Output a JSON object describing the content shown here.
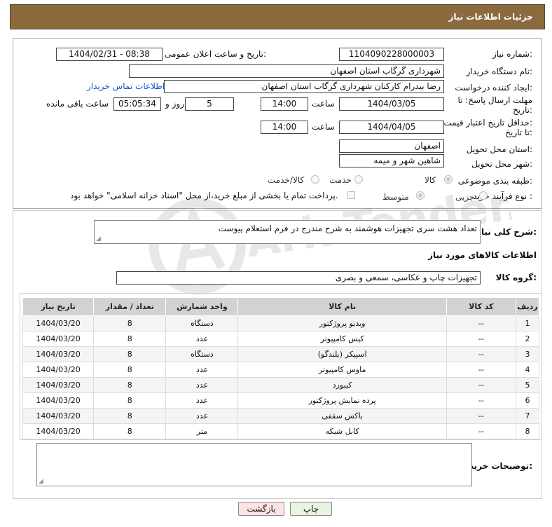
{
  "header": {
    "title": "جزئیات اطلاعات نیاز"
  },
  "form": {
    "need_number": {
      "label": "شماره نیاز:",
      "value": "1104090228000003"
    },
    "announce_datetime": {
      "label": "تاریخ و ساعت اعلان عمومی:",
      "value": "1404/02/31 - 08:38"
    },
    "buyer_org": {
      "label": "نام دستگاه خریدار:",
      "value": "شهرداری گرگاب استان اصفهان"
    },
    "requester": {
      "label": "ایجاد کننده درخواست:",
      "value": "رضا بیدرام کارکنان شهرداری گرگاب استان اصفهان",
      "contact_link": "اطلاعات تماس خریدار"
    },
    "reply_deadline": {
      "label_line1": "مهلت ارسال پاسخ: تا",
      "label_line2": "تاریخ:",
      "date": "1404/03/05",
      "time_label": "ساعت",
      "time": "14:00",
      "days": "5",
      "days_label": "روز و",
      "remaining": "05:05:34",
      "remaining_label": "ساعت باقی مانده"
    },
    "price_validity": {
      "label_line1": "حداقل تاریخ اعتبار قیمت:",
      "label_line2": "تا تاریخ:",
      "date": "1404/04/05",
      "time_label": "ساعت",
      "time": "14:00"
    },
    "delivery_province": {
      "label": "استان محل تحویل:",
      "value": "اصفهان"
    },
    "delivery_city": {
      "label": "شهر محل تحویل:",
      "value": "شاهین شهر و میمه"
    },
    "category": {
      "label": "طبقه بندی موضوعی:",
      "options": [
        "کالا",
        "خدمت",
        "کالا/خدمت"
      ],
      "selected": "کالا"
    },
    "purchase_process": {
      "label": "نوع فرآیند خرید :",
      "options": [
        "جزیی",
        "متوسط"
      ],
      "selected": "متوسط",
      "payment_note": "پرداخت تمام یا بخشی از مبلغ خرید،از محل \"اسناد خزانه اسلامی\" خواهد بود."
    }
  },
  "description": {
    "label": "شرح کلی نیاز:",
    "value": "تعداد هشت سری تجهیزات هوشمند به شرح مندرج در فرم استعلام پیوست"
  },
  "goods_section": {
    "title": "اطلاعات کالاهای مورد نیاز",
    "group_label": "گروه کالا:",
    "group_value": "تجهیزات چاپ و عکاسی، سمعی و بصری"
  },
  "table": {
    "headers": [
      "ردیف",
      "کد کالا",
      "نام کالا",
      "واحد شمارش",
      "تعداد / مقدار",
      "تاریخ نیاز"
    ],
    "rows": [
      [
        "1",
        "--",
        "ویدیو پروژکتور",
        "دستگاه",
        "8",
        "1404/03/20"
      ],
      [
        "2",
        "--",
        "کیس کامپیوتر",
        "عدد",
        "8",
        "1404/03/20"
      ],
      [
        "3",
        "--",
        "اسپیکر (بلندگو)",
        "دستگاه",
        "8",
        "1404/03/20"
      ],
      [
        "4",
        "--",
        "ماوس کامپیوتر",
        "عدد",
        "8",
        "1404/03/20"
      ],
      [
        "5",
        "--",
        "کیبورد",
        "عدد",
        "8",
        "1404/03/20"
      ],
      [
        "6",
        "--",
        "پرده نمایش پروژکتور",
        "عدد",
        "8",
        "1404/03/20"
      ],
      [
        "7",
        "--",
        "باکس سقفی",
        "عدد",
        "8",
        "1404/03/20"
      ],
      [
        "8",
        "--",
        "کابل شبکه",
        "متر",
        "8",
        "1404/03/20"
      ]
    ]
  },
  "buyer_notes": {
    "label": "توضیحات خریدار:",
    "value": ""
  },
  "buttons": {
    "print": "چاپ",
    "back": "بازگشت"
  },
  "watermark": {
    "text": "AriaTender.neT"
  },
  "colors": {
    "header_bg": "#8b6a3e",
    "print_btn": "#e8f5e0",
    "back_btn": "#fde3e3",
    "link": "#1155cc"
  }
}
